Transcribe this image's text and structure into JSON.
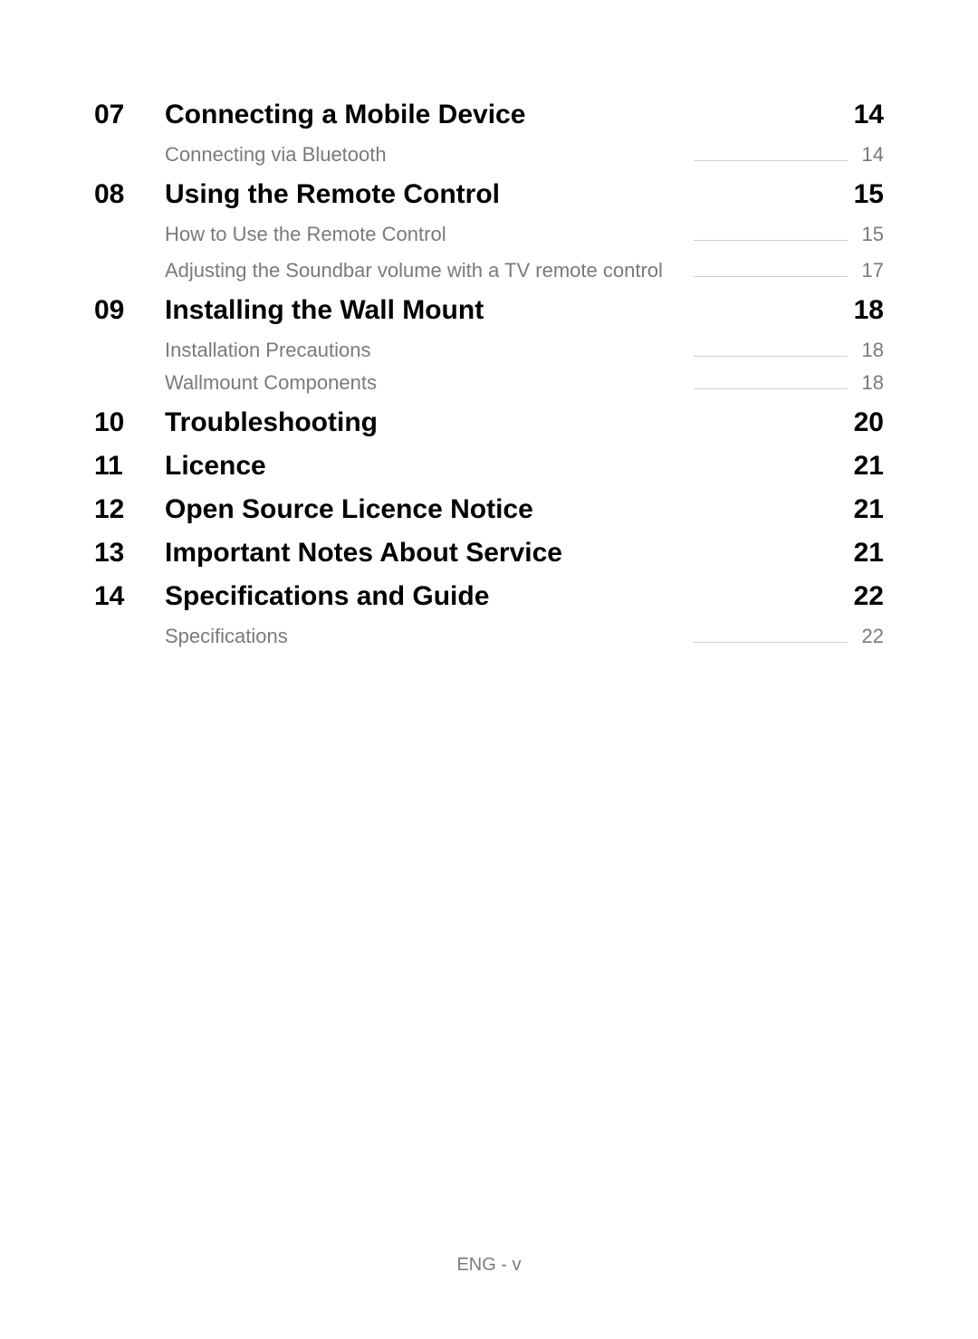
{
  "toc": [
    {
      "number": "07",
      "title": "Connecting a Mobile Device",
      "page": "14",
      "subs": [
        {
          "title": "Connecting via Bluetooth",
          "page": "14"
        }
      ]
    },
    {
      "number": "08",
      "title": "Using the Remote Control",
      "page": "15",
      "subs": [
        {
          "title": "How to Use the Remote Control",
          "page": "15"
        },
        {
          "title": "Adjusting the Soundbar volume with a TV remote control",
          "page": "17"
        }
      ]
    },
    {
      "number": "09",
      "title": "Installing the Wall Mount",
      "page": "18",
      "subs": [
        {
          "title": "Installation Precautions",
          "page": "18"
        },
        {
          "title": "Wallmount Components",
          "page": "18"
        }
      ]
    },
    {
      "number": "10",
      "title": "Troubleshooting",
      "page": "20",
      "subs": []
    },
    {
      "number": "11",
      "title": "Licence",
      "page": "21",
      "subs": []
    },
    {
      "number": "12",
      "title": "Open Source Licence Notice",
      "page": "21",
      "subs": []
    },
    {
      "number": "13",
      "title": "Important Notes About Service",
      "page": "21",
      "subs": []
    },
    {
      "number": "14",
      "title": "Specifications and Guide",
      "page": "22",
      "subs": [
        {
          "title": "Specifications",
          "page": "22"
        }
      ]
    }
  ],
  "footer": "ENG - v"
}
